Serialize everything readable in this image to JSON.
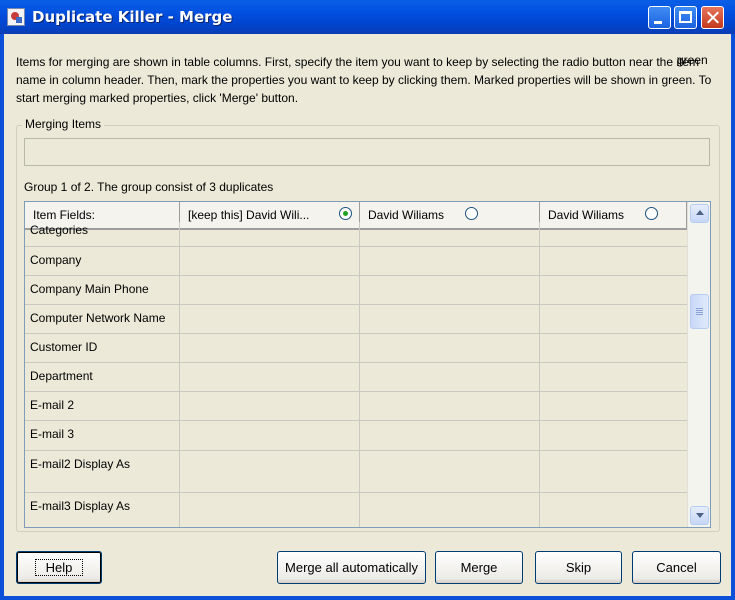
{
  "window": {
    "title": "Duplicate Killer - Merge"
  },
  "instructions": {
    "text": "Items for merging are shown in table columns. First, specify the item you want to keep by selecting the radio button near the item name in column header. Then, mark the properties you want to keep by clicking them. Marked properties will be shown in green. To start merging marked properties, click 'Merge' button.",
    "green_word": "green"
  },
  "merging_items": {
    "legend": "Merging Items",
    "value": ""
  },
  "group_status": "Group 1 of 2. The group consist of 3 duplicates",
  "grid": {
    "header_fields": "Item Fields:",
    "columns": [
      {
        "label": "[keep this] David Wili...",
        "selected": true
      },
      {
        "label": "David Wiliams",
        "selected": false
      },
      {
        "label": "David Wiliams",
        "selected": false
      }
    ],
    "rows": [
      "Categories",
      "Company",
      "Company Main Phone",
      "Computer Network Name",
      "Customer ID",
      "Department",
      "E-mail 2",
      "E-mail 3",
      "E-mail2 Display As",
      "E-mail3 Display As"
    ]
  },
  "buttons": {
    "help": "Help",
    "merge_auto": "Merge all automatically",
    "merge": "Merge",
    "skip": "Skip",
    "cancel": "Cancel"
  },
  "icons": [
    "app-icon",
    "minimize-icon",
    "maximize-icon",
    "close-icon",
    "radio-selected-icon",
    "radio-icon",
    "scroll-up-icon",
    "scroll-down-icon"
  ],
  "colors": {
    "titlebar": "#0054E3",
    "dialog_bg": "#ECE9D8",
    "radio_selected": "#21A121"
  }
}
